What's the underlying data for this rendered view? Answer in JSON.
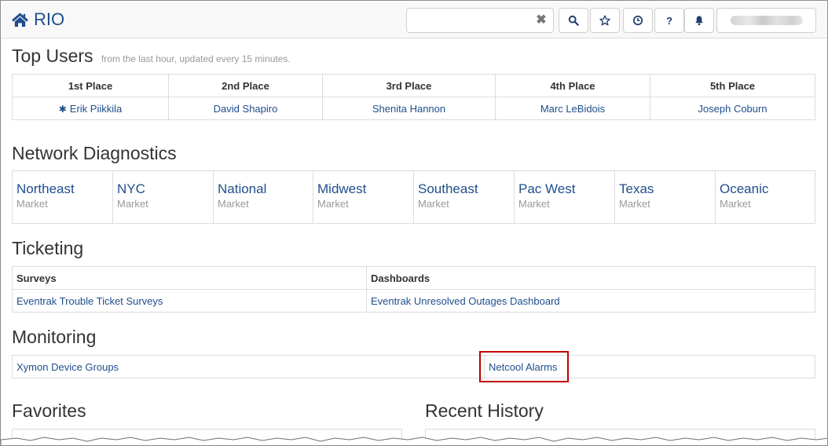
{
  "brand": {
    "title": "RIO",
    "icon": "home-icon"
  },
  "navbar": {
    "search_value": "",
    "clear_icon": "close-icon",
    "buttons": [
      {
        "name": "search-button",
        "icon": "search-icon"
      },
      {
        "name": "favorites-button",
        "icon": "star-icon"
      },
      {
        "name": "history-button",
        "icon": "clock-icon"
      },
      {
        "name": "help-button",
        "icon": "question-icon",
        "label": "?"
      },
      {
        "name": "notifications-button",
        "icon": "bell-icon"
      }
    ],
    "user_icon": "blurred-username"
  },
  "top_users": {
    "title": "Top Users",
    "subtitle": "from the last hour, updated every 15 minutes.",
    "headers": [
      "1st Place",
      "2nd Place",
      "3rd Place",
      "4th Place",
      "5th Place"
    ],
    "users": [
      "Erik Piikkila",
      "David Shapiro",
      "Shenita Hannon",
      "Marc LeBidois",
      "Joseph Coburn"
    ],
    "leader_icon": "asterisk-icon"
  },
  "network": {
    "title": "Network Diagnostics",
    "markets": [
      {
        "name": "Northeast",
        "sub": "Market"
      },
      {
        "name": "NYC",
        "sub": "Market"
      },
      {
        "name": "National",
        "sub": "Market"
      },
      {
        "name": "Midwest",
        "sub": "Market"
      },
      {
        "name": "Southeast",
        "sub": "Market"
      },
      {
        "name": "Pac West",
        "sub": "Market"
      },
      {
        "name": "Texas",
        "sub": "Market"
      },
      {
        "name": "Oceanic",
        "sub": "Market"
      }
    ]
  },
  "ticketing": {
    "title": "Ticketing",
    "headers": [
      "Surveys",
      "Dashboards"
    ],
    "links": [
      "Eventrak Trouble Ticket Surveys",
      "Eventrak Unresolved Outages Dashboard"
    ]
  },
  "monitoring": {
    "title": "Monitoring",
    "links": [
      "Xymon Device Groups",
      "Netcool Alarms"
    ],
    "highlight_color": "#c00000"
  },
  "favorites": {
    "title": "Favorites"
  },
  "recent": {
    "title": "Recent History"
  },
  "colors": {
    "link": "#1f4e8c",
    "muted": "#999999",
    "border": "#dcdcdc"
  }
}
